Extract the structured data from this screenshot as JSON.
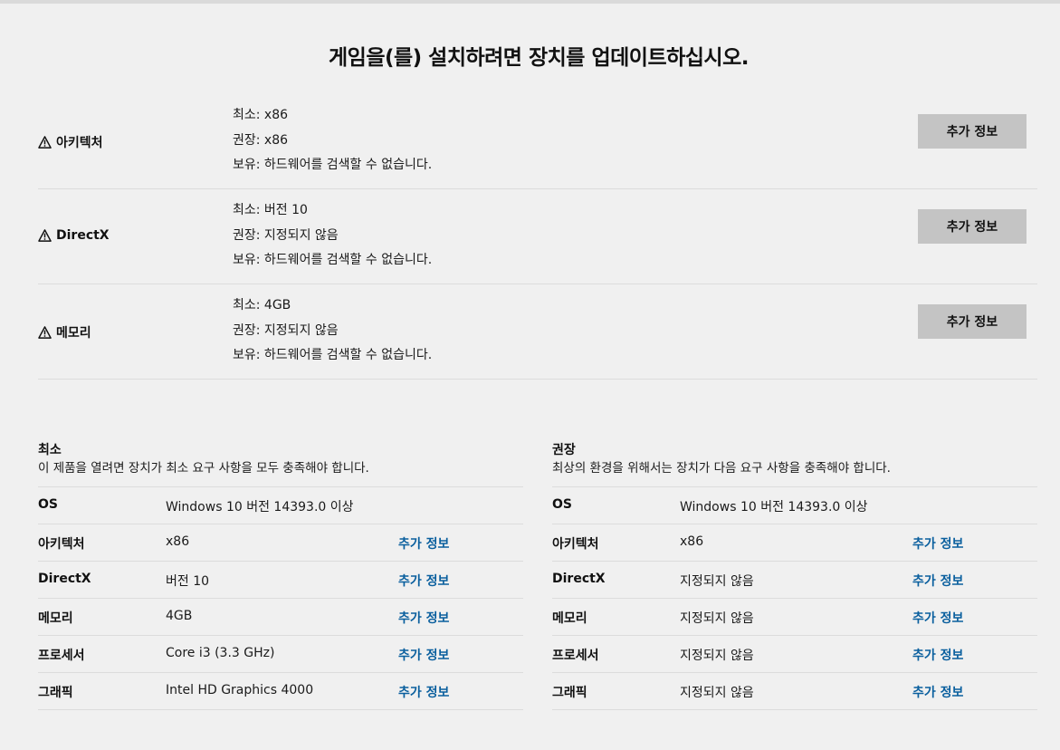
{
  "title": "게임을(를) 설치하려면 장치를 업데이트하십시오.",
  "issues": [
    {
      "name": "아키텍처",
      "lines": [
        "최소: x86",
        "권장: x86",
        "보유: 하드웨어를 검색할 수 없습니다."
      ],
      "button": "추가 정보"
    },
    {
      "name": "DirectX",
      "lines": [
        "최소: 버전 10",
        "권장: 지정되지 않음",
        "보유: 하드웨어를 검색할 수 없습니다."
      ],
      "button": "추가 정보"
    },
    {
      "name": "메모리",
      "lines": [
        "최소: 4GB",
        "권장: 지정되지 않음",
        "보유: 하드웨어를 검색할 수 없습니다."
      ],
      "button": "추가 정보"
    }
  ],
  "minimum": {
    "title": "최소",
    "description": "이 제품을 열려면 장치가 최소 요구 사항을 모두 충족해야 합니다.",
    "rows": [
      {
        "label": "OS",
        "value": "Windows 10 버전 14393.0 이상",
        "link": ""
      },
      {
        "label": "아키텍처",
        "value": "x86",
        "link": "추가 정보"
      },
      {
        "label": "DirectX",
        "value": "버전 10",
        "link": "추가 정보"
      },
      {
        "label": "메모리",
        "value": "4GB",
        "link": "추가 정보"
      },
      {
        "label": "프로세서",
        "value": "Core i3 (3.3 GHz)",
        "link": "추가 정보"
      },
      {
        "label": "그래픽",
        "value": "Intel HD Graphics 4000",
        "link": "추가 정보"
      }
    ]
  },
  "recommended": {
    "title": "권장",
    "description": "최상의 환경을 위해서는 장치가 다음 요구 사항을 충족해야 합니다.",
    "rows": [
      {
        "label": "OS",
        "value": "Windows 10 버전 14393.0 이상",
        "link": ""
      },
      {
        "label": "아키텍처",
        "value": "x86",
        "link": "추가 정보"
      },
      {
        "label": "DirectX",
        "value": "지정되지 않음",
        "link": "추가 정보"
      },
      {
        "label": "메모리",
        "value": "지정되지 않음",
        "link": "추가 정보"
      },
      {
        "label": "프로세서",
        "value": "지정되지 않음",
        "link": "추가 정보"
      },
      {
        "label": "그래픽",
        "value": "지정되지 않음",
        "link": "추가 정보"
      }
    ]
  },
  "colors": {
    "background": "#f0f0f0",
    "button": "#c4c4c4",
    "link": "#0a5f9e",
    "divider": "#dcdcdc"
  },
  "icons": {
    "issue": "warning-icon"
  }
}
